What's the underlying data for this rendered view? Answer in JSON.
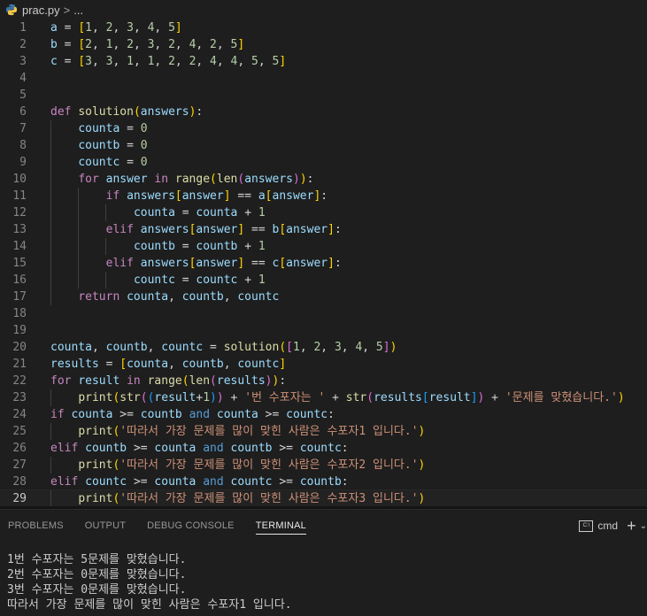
{
  "breadcrumb": {
    "file": "prac.py",
    "separator": ">",
    "more": "..."
  },
  "code_lines": [
    "a = [1, 2, 3, 4, 5]",
    "b = [2, 1, 2, 3, 2, 4, 2, 5]",
    "c = [3, 3, 1, 1, 2, 2, 4, 4, 5, 5]",
    "",
    "",
    "def solution(answers):",
    "    counta = 0",
    "    countb = 0",
    "    countc = 0",
    "    for answer in range(len(answers)):",
    "        if answers[answer] == a[answer]:",
    "            counta = counta + 1",
    "        elif answers[answer] == b[answer]:",
    "            countb = countb + 1",
    "        elif answers[answer] == c[answer]:",
    "            countc = countc + 1",
    "    return counta, countb, countc",
    "",
    "",
    "counta, countb, countc = solution([1, 2, 3, 4, 5])",
    "results = [counta, countb, countc]",
    "for result in range(len(results)):",
    "    print(str((result+1)) + '번 수포자는 ' + str(results[result]) + '문제를 맞혔습니다.')",
    "if counta >= countb and counta >= countc:",
    "    print('따라서 가장 문제를 많이 맞힌 사람은 수포자1 입니다.')",
    "elif countb >= counta and countb >= countc:",
    "    print('따라서 가장 문제를 많이 맞힌 사람은 수포자2 입니다.')",
    "elif countc >= counta and countc >= countb:",
    "    print('따라서 가장 문제를 많이 맞힌 사람은 수포자3 입니다.')"
  ],
  "current_line": 29,
  "panel": {
    "tabs": [
      "PROBLEMS",
      "OUTPUT",
      "DEBUG CONSOLE",
      "TERMINAL"
    ],
    "active_tab": "TERMINAL",
    "terminal_label": "cmd",
    "terminal_icon_text": "C:\\"
  },
  "terminal_output": [
    "1번 수포자는 5문제를 맞혔습니다.",
    "2번 수포자는 0문제를 맞혔습니다.",
    "3번 수포자는 0문제를 맞혔습니다.",
    "따라서 가장 문제를 많이 맞힌 사람은 수포자1 입니다."
  ]
}
